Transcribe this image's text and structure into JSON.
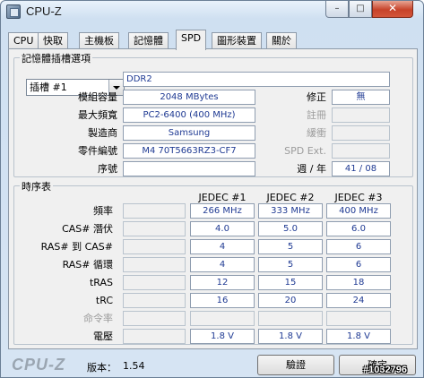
{
  "window": {
    "title": "CPU-Z",
    "min": "–",
    "max": "□",
    "close": "✕"
  },
  "tabs": [
    {
      "label": "CPU",
      "active": false
    },
    {
      "label": "快取",
      "active": false
    },
    {
      "label": "主機板",
      "active": false
    },
    {
      "label": "記憶體",
      "active": false
    },
    {
      "label": "SPD",
      "active": true
    },
    {
      "label": "圖形裝置",
      "active": false
    },
    {
      "label": "關於",
      "active": false
    }
  ],
  "slot_group": {
    "legend": "記憶體插槽選項",
    "slot_selected": "插槽 #1",
    "type": "DDR2",
    "labels": {
      "module_size": "模組容量",
      "max_bandwidth": "最大頻寬",
      "manufacturer": "製造商",
      "part_number": "零件編號",
      "serial": "序號",
      "correction": "修正",
      "registered": "註冊",
      "buffered": "緩衝",
      "spd_ext": "SPD Ext.",
      "week_year": "週 / 年"
    },
    "values": {
      "module_size": "2048 MBytes",
      "max_bandwidth": "PC2-6400 (400 MHz)",
      "manufacturer": "Samsung",
      "part_number": "M4 70T5663RZ3-CF7",
      "serial": "",
      "correction": "無",
      "registered": "",
      "buffered": "",
      "spd_ext": "",
      "week_year": "41 / 08"
    }
  },
  "timings": {
    "legend": "時序表",
    "columns": [
      "JEDEC #1",
      "JEDEC #2",
      "JEDEC #3"
    ],
    "rows": [
      {
        "label": "頻率",
        "values": [
          "266 MHz",
          "333 MHz",
          "400 MHz"
        ],
        "dim": false
      },
      {
        "label": "CAS# 潛伏",
        "values": [
          "4.0",
          "5.0",
          "6.0"
        ],
        "dim": false
      },
      {
        "label": "RAS# 到 CAS#",
        "values": [
          "4",
          "5",
          "6"
        ],
        "dim": false
      },
      {
        "label": "RAS# 循環",
        "values": [
          "4",
          "5",
          "6"
        ],
        "dim": false
      },
      {
        "label": "tRAS",
        "values": [
          "12",
          "15",
          "18"
        ],
        "dim": false
      },
      {
        "label": "tRC",
        "values": [
          "16",
          "20",
          "24"
        ],
        "dim": false
      },
      {
        "label": "命令率",
        "values": [
          "",
          "",
          ""
        ],
        "dim": true
      },
      {
        "label": "電壓",
        "values": [
          "1.8 V",
          "1.8 V",
          "1.8 V"
        ],
        "dim": false
      }
    ]
  },
  "footer": {
    "logo": "CPU-Z",
    "version_label": "版本：",
    "version": "1.54",
    "validate": "驗證",
    "ok": "確定"
  },
  "watermark": "#1032796",
  "colors": {
    "value_text": "#1f3a93",
    "close_button": "#c7432a"
  }
}
